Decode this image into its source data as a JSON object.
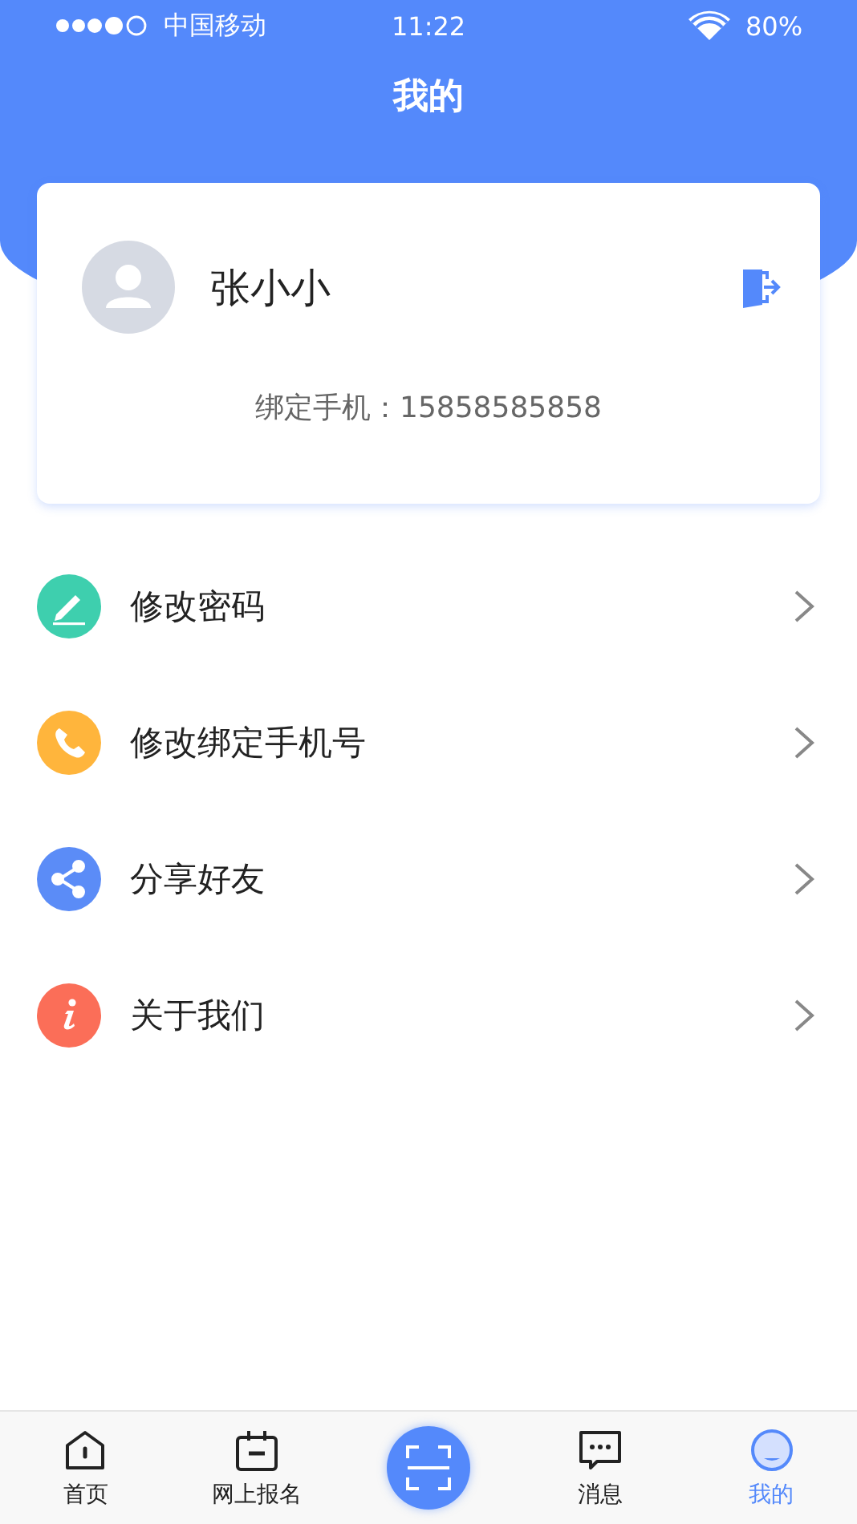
{
  "status_bar": {
    "carrier": "中国移动",
    "time": "11:22",
    "battery": "80%"
  },
  "header": {
    "title": "我的"
  },
  "profile": {
    "name": "张小小",
    "phone_label": "绑定手机：15858585858"
  },
  "menu": [
    {
      "kind": "edit",
      "label": "修改密码",
      "color": "#3ecfae"
    },
    {
      "kind": "phone",
      "label": "修改绑定手机号",
      "color": "#ffb53c"
    },
    {
      "kind": "share",
      "label": "分享好友",
      "color": "#5b8cf7"
    },
    {
      "kind": "info",
      "label": "关于我们",
      "color": "#fb6e58"
    }
  ],
  "tabs": [
    {
      "kind": "home",
      "label": "首页",
      "selected": false
    },
    {
      "kind": "calendar",
      "label": "网上报名",
      "selected": false
    },
    {
      "kind": "scan",
      "selected": false
    },
    {
      "kind": "message",
      "label": "消息",
      "selected": false
    },
    {
      "kind": "me",
      "label": "我的",
      "selected": true
    }
  ]
}
